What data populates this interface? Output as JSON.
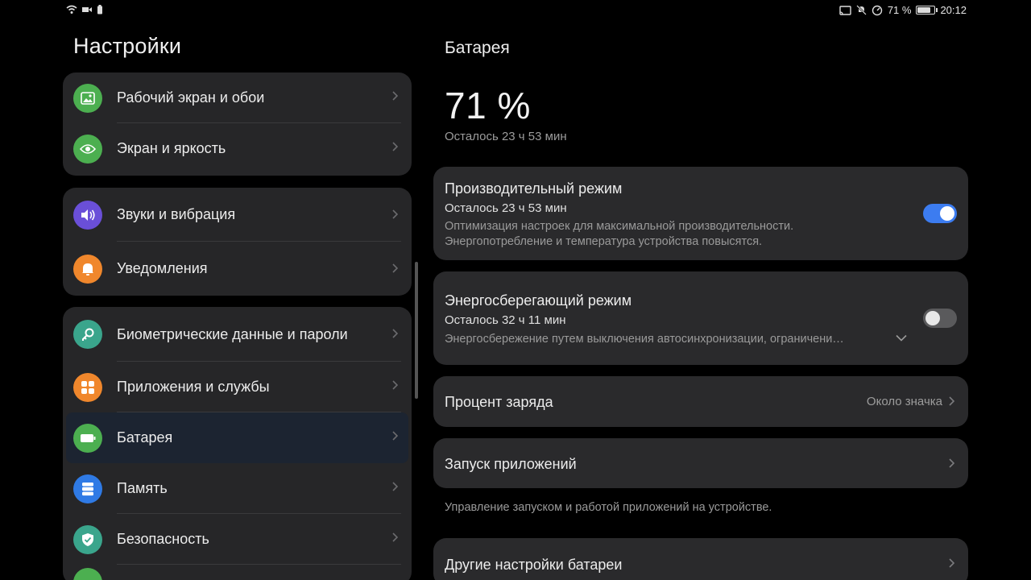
{
  "status_bar": {
    "battery_percent_text": "71 %",
    "battery_level": 0.71,
    "time": "20:12"
  },
  "left": {
    "title": "Настройки",
    "groups": [
      {
        "items": [
          {
            "label": "Рабочий экран и обои",
            "icon": "image-icon",
            "color": "#4caf50"
          },
          {
            "label": "Экран и яркость",
            "icon": "eye-icon",
            "color": "#4caf50"
          }
        ]
      },
      {
        "items": [
          {
            "label": "Звуки и вибрация",
            "icon": "speaker-icon",
            "color": "#6a4fd8"
          },
          {
            "label": "Уведомления",
            "icon": "bell-icon",
            "color": "#f0872c"
          }
        ]
      },
      {
        "items": [
          {
            "label": "Биометрические данные и пароли",
            "icon": "key-icon",
            "color": "#3aa58c"
          },
          {
            "label": "Приложения и службы",
            "icon": "apps-icon",
            "color": "#f0872c"
          },
          {
            "label": "Батарея",
            "icon": "battery-icon",
            "color": "#4caf50",
            "active": true
          },
          {
            "label": "Память",
            "icon": "storage-icon",
            "color": "#2f7ae5"
          },
          {
            "label": "Безопасность",
            "icon": "shield-icon",
            "color": "#3aa58c"
          }
        ]
      }
    ]
  },
  "right": {
    "title": "Батарея",
    "percent": "71 %",
    "remaining": "Осталось 23 ч 53 мин",
    "performance_mode": {
      "title": "Производительный режим",
      "subtitle": "Осталось 23 ч 53 мин",
      "description_line1": "Оптимизация настроек для максимальной производительности.",
      "description_line2": "Энергопотребление и температура устройства повысятся.",
      "enabled": true
    },
    "power_saving_mode": {
      "title": "Энергосберегающий режим",
      "subtitle": "Осталось 32 ч 11 мин",
      "description": "Энергосбережение путем выключения автосинхронизации, ограничени…",
      "enabled": false
    },
    "battery_percentage": {
      "title": "Процент заряда",
      "value": "Около значка"
    },
    "app_launch": {
      "title": "Запуск приложений",
      "note": "Управление запуском и работой приложений на устройстве."
    },
    "more_battery_settings": {
      "title": "Другие настройки батареи"
    }
  },
  "colors": {
    "accent": "#3c7cf0",
    "card_bg": "#2a2a2c",
    "group_bg": "#262628",
    "active_row_bg": "#1c2431"
  }
}
